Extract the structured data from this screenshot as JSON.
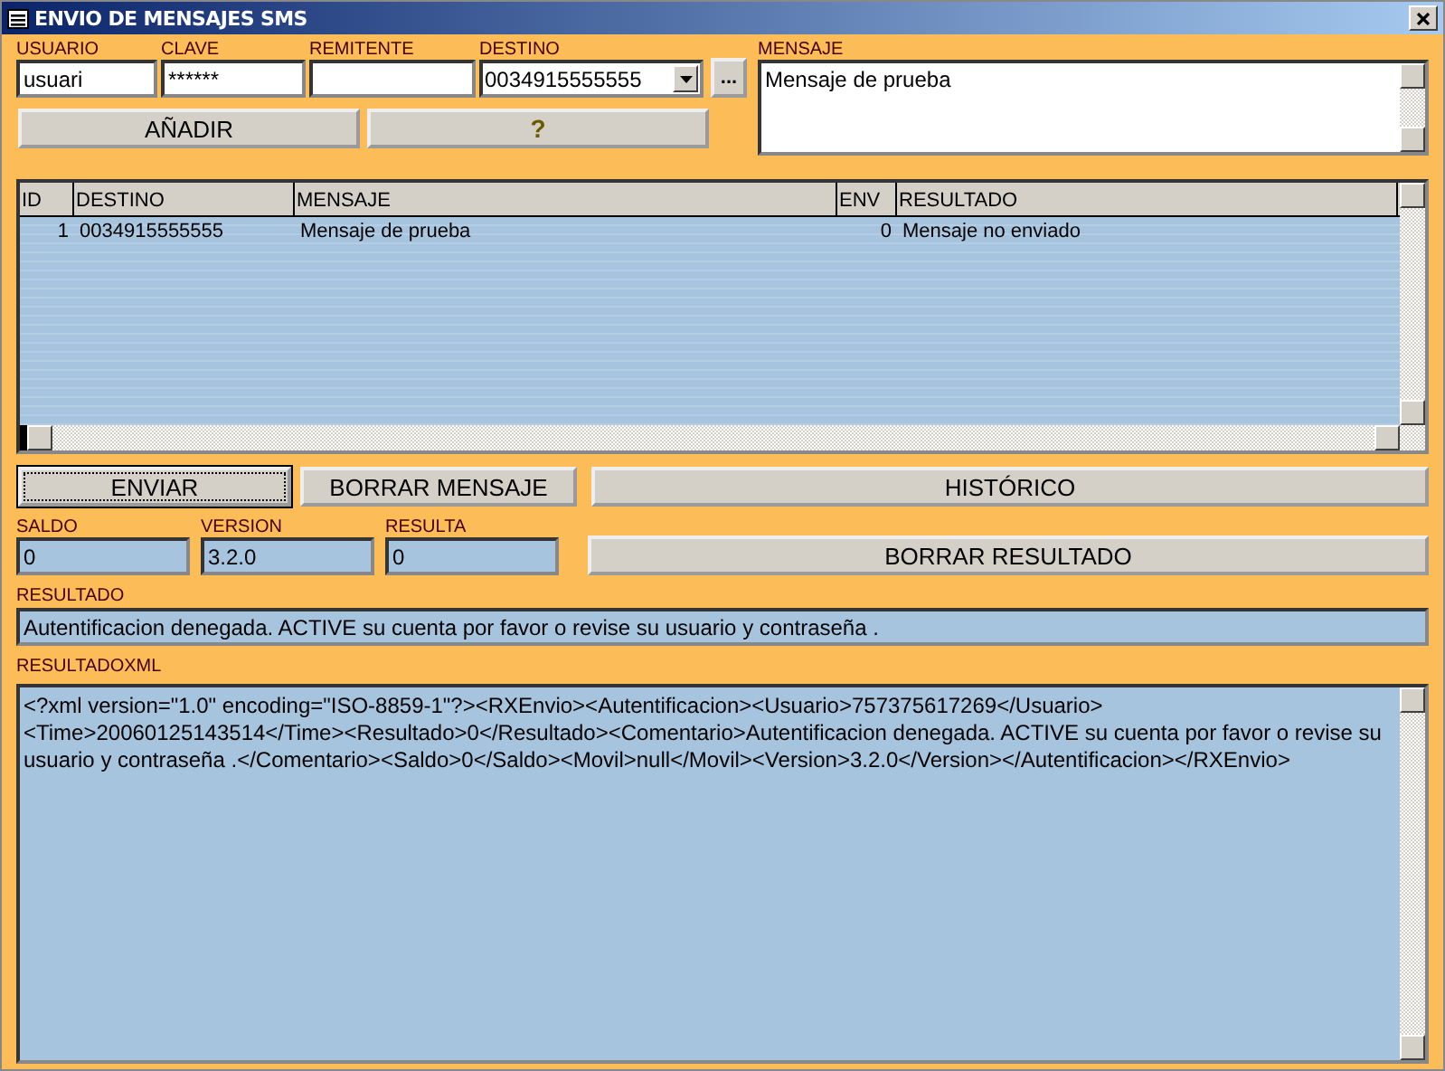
{
  "window": {
    "title": "ENVIO DE MENSAJES SMS"
  },
  "fields": [
    {
      "label": "USUARIO",
      "value": "usuari",
      "kind": "text"
    },
    {
      "label": "CLAVE",
      "value": "******",
      "kind": "text"
    },
    {
      "label": "REMITENTE",
      "kind": "text"
    },
    {
      "label": "DESTINO",
      "value": "0034915555555",
      "kind": "combo"
    }
  ],
  "browse_button": "...",
  "message": {
    "label": "MENSAJE",
    "value": "Mensaje de prueba"
  },
  "add_buttons": [
    {
      "label": "AÑADIR",
      "kind": "text"
    },
    {
      "label": "?",
      "kind": "help"
    }
  ],
  "table": {
    "columns": [
      {
        "label": "ID"
      },
      {
        "label": "DESTINO"
      },
      {
        "label": "MENSAJE"
      },
      {
        "label": "ENV"
      },
      {
        "label": "RESULTADO"
      }
    ],
    "rows": [
      [
        "1",
        "0034915555555",
        "Mensaje de prueba",
        "0",
        "Mensaje no enviado"
      ]
    ]
  },
  "action_buttons": [
    {
      "label": "ENVIAR",
      "focused": true
    },
    {
      "label": "BORRAR MENSAJE",
      "focused": false
    },
    {
      "label": "HISTÓRICO",
      "focused": false
    }
  ],
  "status_fields": [
    {
      "label": "SALDO",
      "value": "0"
    },
    {
      "label": "VERSION",
      "value": "3.2.0"
    },
    {
      "label": "RESULTA",
      "value": "0"
    }
  ],
  "clear_button": "BORRAR RESULTADO",
  "result": {
    "label": "RESULTADO",
    "value": "Autentificacion denegada. ACTIVE su cuenta por favor o revise su usuario y contraseña ."
  },
  "result_xml": {
    "label": "RESULTADOXML",
    "value": "<?xml version=\"1.0\" encoding=\"ISO-8859-1\"?><RXEnvio><Autentificacion><Usuario>757375617269</Usuario><Time>20060125143514</Time><Resultado>0</Resultado><Comentario>Autentificacion denegada. ACTIVE su cuenta por favor o revise su usuario y contraseña .</Comentario><Saldo>0</Saldo><Movil>null</Movil><Version>3.2.0</Version></Autentificacion></RXEnvio>"
  }
}
